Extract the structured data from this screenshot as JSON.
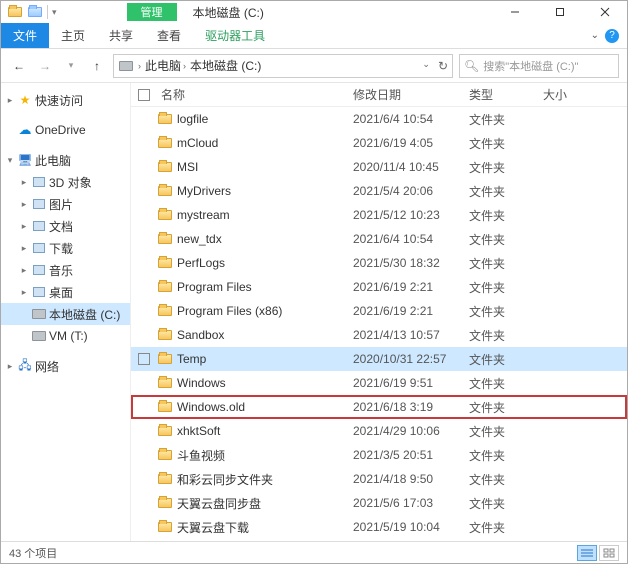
{
  "titlebar": {
    "manage_label": "管理",
    "window_title": "本地磁盘 (C:)"
  },
  "ribbon": {
    "tabs": [
      "文件",
      "主页",
      "共享",
      "查看",
      "驱动器工具"
    ]
  },
  "nav": {
    "breadcrumb": [
      "此电脑",
      "本地磁盘 (C:)"
    ],
    "search_placeholder": "搜索\"本地磁盘 (C:)\""
  },
  "sidebar": {
    "quick_access": "快速访问",
    "onedrive": "OneDrive",
    "this_pc": "此电脑",
    "objects_3d": "3D 对象",
    "pictures": "图片",
    "documents": "文档",
    "downloads": "下载",
    "music": "音乐",
    "desktop": "桌面",
    "local_disk": "本地磁盘 (C:)",
    "vm": "VM (T:)",
    "network": "网络"
  },
  "columns": {
    "name": "名称",
    "date": "修改日期",
    "type": "类型",
    "size": "大小"
  },
  "folder_type": "文件夹",
  "files": [
    {
      "name": "logfile",
      "date": "2021/6/4 10:54"
    },
    {
      "name": "mCloud",
      "date": "2021/6/19 4:05"
    },
    {
      "name": "MSI",
      "date": "2020/11/4 10:45"
    },
    {
      "name": "MyDrivers",
      "date": "2021/5/4 20:06"
    },
    {
      "name": "mystream",
      "date": "2021/5/12 10:23"
    },
    {
      "name": "new_tdx",
      "date": "2021/6/4 10:54"
    },
    {
      "name": "PerfLogs",
      "date": "2021/5/30 18:32"
    },
    {
      "name": "Program Files",
      "date": "2021/6/19 2:21"
    },
    {
      "name": "Program Files (x86)",
      "date": "2021/6/19 2:21"
    },
    {
      "name": "Sandbox",
      "date": "2021/4/13 10:57"
    },
    {
      "name": "Temp",
      "date": "2020/10/31 22:57",
      "selected": true
    },
    {
      "name": "Windows",
      "date": "2021/6/19 9:51"
    },
    {
      "name": "Windows.old",
      "date": "2021/6/18 3:19",
      "highlighted": true
    },
    {
      "name": "xhktSoft",
      "date": "2021/4/29 10:06"
    },
    {
      "name": "斗鱼视频",
      "date": "2021/3/5 20:51"
    },
    {
      "name": "和彩云同步文件夹",
      "date": "2021/4/18 9:50"
    },
    {
      "name": "天翼云盘同步盘",
      "date": "2021/5/6 17:03"
    },
    {
      "name": "天翼云盘下载",
      "date": "2021/5/19 10:04"
    }
  ],
  "status": {
    "item_count": "43 个项目"
  }
}
